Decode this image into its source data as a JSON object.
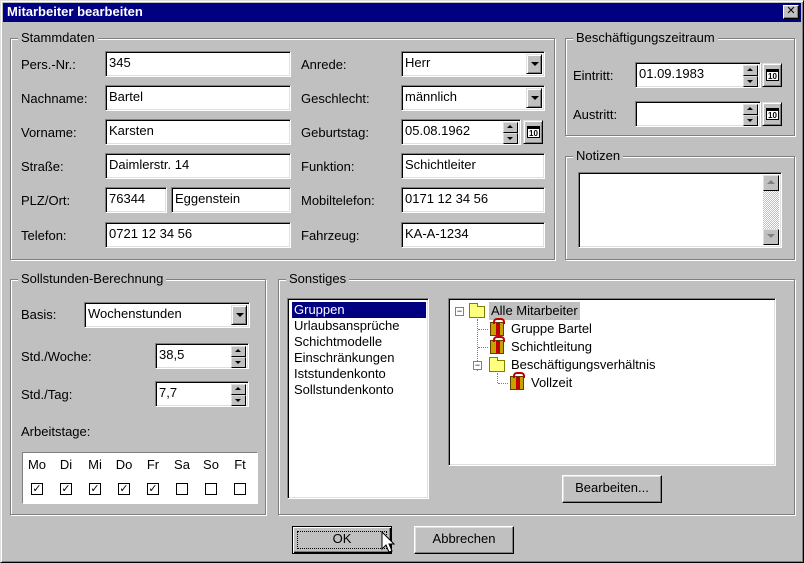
{
  "window": {
    "title": "Mitarbeiter bearbeiten",
    "close_glyph": "✕"
  },
  "stammdaten": {
    "legend": "Stammdaten",
    "pers_nr": {
      "label": "Pers.-Nr.:",
      "value": "345"
    },
    "nachname": {
      "label": "Nachname:",
      "value": "Bartel"
    },
    "vorname": {
      "label": "Vorname:",
      "value": "Karsten"
    },
    "strasse": {
      "label": "Straße:",
      "value": "Daimlerstr. 14"
    },
    "plz_ort": {
      "label": "PLZ/Ort:",
      "plz": "76344",
      "ort": "Eggenstein"
    },
    "telefon": {
      "label": "Telefon:",
      "value": "0721 12 34 56"
    },
    "anrede": {
      "label": "Anrede:",
      "value": "Herr"
    },
    "geschlecht": {
      "label": "Geschlecht:",
      "value": "männlich"
    },
    "geburtstag": {
      "label": "Geburtstag:",
      "value": "05.08.1962"
    },
    "funktion": {
      "label": "Funktion:",
      "value": "Schichtleiter"
    },
    "mobiltelefon": {
      "label": "Mobiltelefon:",
      "value": "0171 12 34 56"
    },
    "fahrzeug": {
      "label": "Fahrzeug:",
      "value": "KA-A-1234"
    }
  },
  "beschaeftigung": {
    "legend": "Beschäftigungszeitraum",
    "eintritt": {
      "label": "Eintritt:",
      "value": "01.09.1983"
    },
    "austritt": {
      "label": "Austritt:",
      "value": ""
    },
    "cal_glyph": "10"
  },
  "notizen": {
    "legend": "Notizen",
    "value": ""
  },
  "sollstunden": {
    "legend": "Sollstunden-Berechnung",
    "basis": {
      "label": "Basis:",
      "value": "Wochenstunden"
    },
    "std_woche": {
      "label": "Std./Woche:",
      "value": "38,5"
    },
    "std_tag": {
      "label": "Std./Tag:",
      "value": "7,7"
    },
    "arbeitstage_label": "Arbeitstage:",
    "days": [
      {
        "label": "Mo",
        "checked": true
      },
      {
        "label": "Di",
        "checked": true
      },
      {
        "label": "Mi",
        "checked": true
      },
      {
        "label": "Do",
        "checked": true
      },
      {
        "label": "Fr",
        "checked": true
      },
      {
        "label": "Sa",
        "checked": false
      },
      {
        "label": "So",
        "checked": false
      },
      {
        "label": "Ft",
        "checked": false
      }
    ]
  },
  "sonstiges": {
    "legend": "Sonstiges",
    "categories": [
      "Gruppen",
      "Urlaubsansprüche",
      "Schichtmodelle",
      "Einschränkungen",
      "Iststundenkonto",
      "Sollstundenkonto"
    ],
    "selected_category": "Gruppen",
    "tree": [
      {
        "label": "Alle Mitarbeiter",
        "icon": "folder-icon"
      },
      {
        "label": "Gruppe Bartel",
        "icon": "gift-icon"
      },
      {
        "label": "Schichtleitung",
        "icon": "gift-icon"
      },
      {
        "label": "Beschäftigungsverhältnis",
        "icon": "folder-icon"
      },
      {
        "label": "Vollzeit",
        "icon": "gift-icon"
      }
    ],
    "edit_button": "Bearbeiten..."
  },
  "buttons": {
    "ok": "OK",
    "cancel": "Abbrechen"
  },
  "check_glyph": "✓",
  "colors": {
    "title_bar": "#000080",
    "face": "#c0c0c0",
    "selection": "#000080"
  }
}
